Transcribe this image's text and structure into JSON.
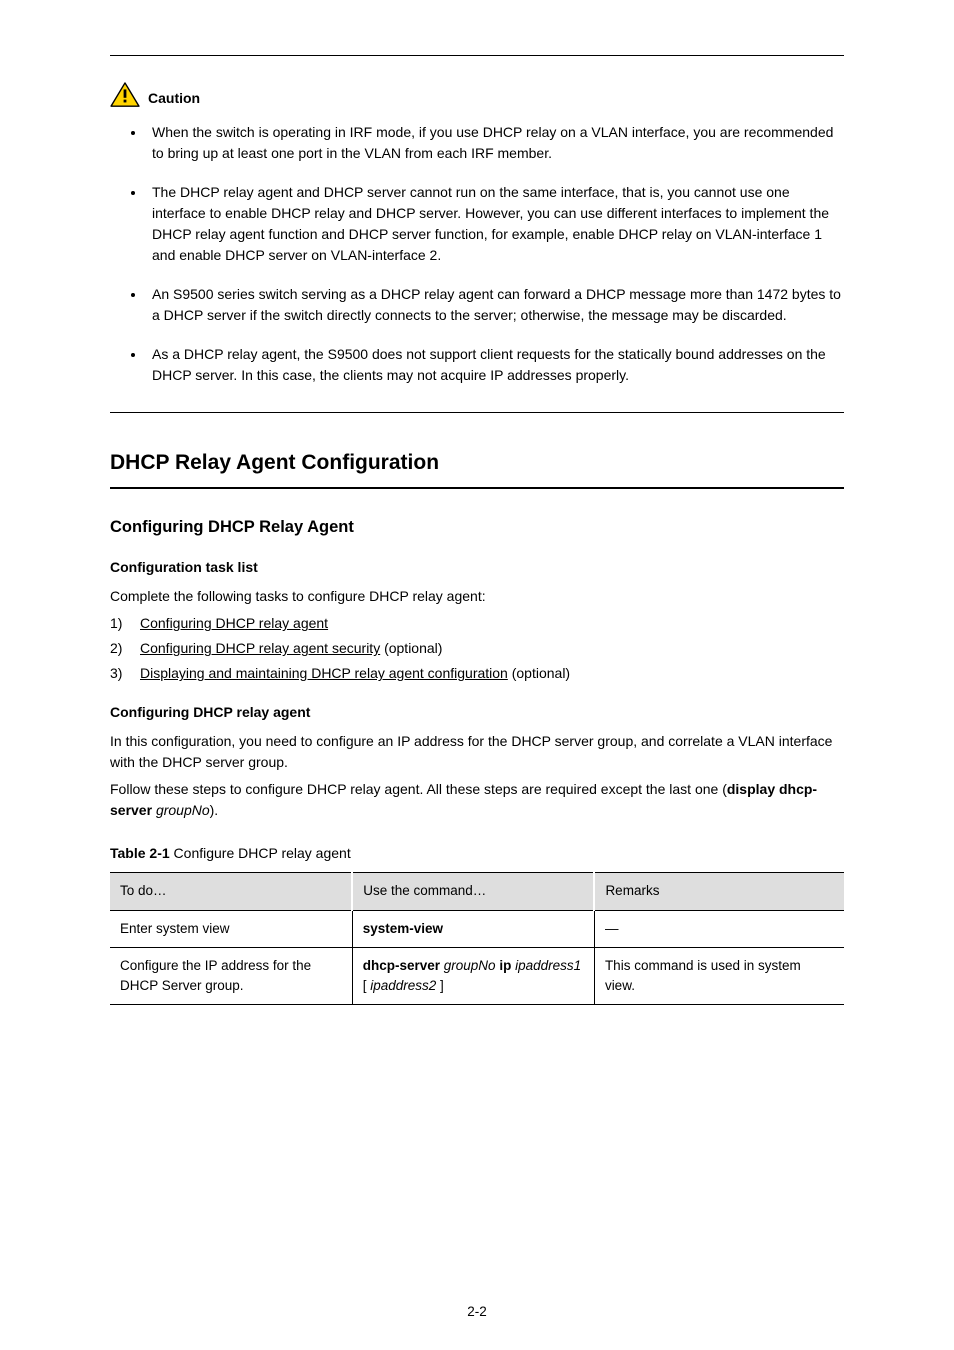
{
  "caution": {
    "label": "Caution",
    "bullets": [
      "When the switch is operating in IRF mode, if you use DHCP relay on a VLAN interface, you are recommended to bring up at least one port in the VLAN from each IRF member.",
      "The DHCP relay agent and DHCP server cannot run on the same interface, that is, you cannot use one interface to enable DHCP relay and DHCP server. However, you can use different interfaces to implement the DHCP relay agent function and DHCP server function, for example, enable DHCP relay on VLAN-interface 1 and enable DHCP server on VLAN-interface 2.",
      "An S9500 series switch serving as a DHCP relay agent can forward a DHCP message more than 1472 bytes to a DHCP server if the switch directly connects to the server; otherwise, the message may be discarded.",
      "As a DHCP relay agent, the S9500 does not support client requests for the statically bound addresses on the DHCP server. In this case, the clients may not acquire IP addresses properly."
    ]
  },
  "sections": {
    "s1": {
      "title": "DHCP Relay Agent Configuration",
      "subs": {
        "dhcp_relay": {
          "title": "Configuring DHCP Relay Agent",
          "blocks": {
            "task_list": {
              "title": "Configuration task list",
              "intro": "Complete the following tasks to configure DHCP relay agent:",
              "items": [
                {
                  "num": "1)",
                  "text_prefix": "",
                  "link": "Configuring DHCP relay agent",
                  "text_suffix": ""
                },
                {
                  "num": "2)",
                  "text_prefix": "",
                  "link": "Configuring DHCP relay agent security",
                  "text_suffix": " (optional)"
                },
                {
                  "num": "3)",
                  "text_prefix": "",
                  "link": "Displaying and maintaining DHCP relay agent configuration",
                  "text_suffix": " (optional)"
                }
              ]
            },
            "config_relay": {
              "title": "Configuring DHCP relay agent",
              "p1": "In this configuration, you need to configure an IP address for the DHCP server group, and correlate a VLAN interface with the DHCP server group.",
              "p2_prefix": "Follow these steps to configure DHCP relay agent. All these steps are required except the last one (",
              "p2_cmd": "display dhcp-server",
              "p2_group": "groupNo",
              "p2_suffix": ")."
            }
          }
        }
      }
    }
  },
  "table": {
    "caption_prefix": "Table 2-1",
    "caption_text": " Configure DHCP relay agent",
    "headers": [
      "To do…",
      "Use the command…",
      "Remarks"
    ],
    "rows": [
      {
        "c1": "Enter system view",
        "c2_cmd": "system-view",
        "c2_extra": "",
        "c3": "—"
      },
      {
        "c1": "Configure the IP address for the DHCP Server group.",
        "c2_cmd": "dhcp-server",
        "c2_args_italic": "groupNo",
        "c2_plain": " ip ",
        "c2_args2_italic": "ipaddress1",
        "c2_opt_open": "[ ",
        "c2_args3_italic": "ipaddress2",
        "c2_opt_close": " ]",
        "c3": "This command is used in system view."
      }
    ]
  },
  "footer": "2-2"
}
